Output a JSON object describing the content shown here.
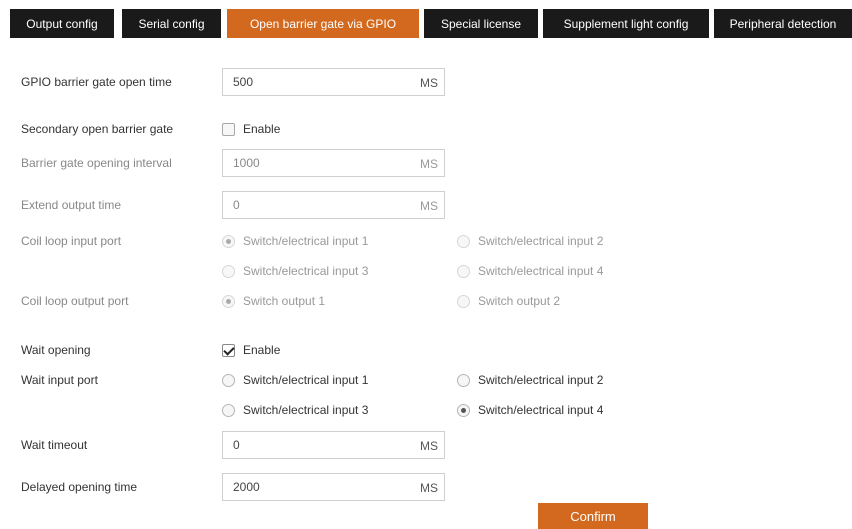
{
  "tabs": [
    {
      "label": "Output config"
    },
    {
      "label": "Serial config"
    },
    {
      "label": "Open barrier gate via GPIO"
    },
    {
      "label": "Special license"
    },
    {
      "label": "Supplement light config"
    },
    {
      "label": "Peripheral detection"
    }
  ],
  "active_tab": "Open barrier gate via GPIO",
  "form": {
    "gpio_open_time": {
      "label": "GPIO barrier gate open time",
      "value": "500",
      "unit": "MS"
    },
    "secondary_open": {
      "label": "Secondary open barrier gate",
      "option": "Enable",
      "checked": false
    },
    "opening_interval": {
      "label": "Barrier gate opening interval",
      "value": "1000",
      "unit": "MS"
    },
    "extend_output": {
      "label": "Extend output time",
      "value": "0",
      "unit": "MS"
    },
    "coil_input": {
      "label": "Coil loop input port",
      "options": [
        "Switch/electrical input 1",
        "Switch/electrical input 2",
        "Switch/electrical input 3",
        "Switch/electrical input 4"
      ],
      "selected": "Switch/electrical input 1"
    },
    "coil_output": {
      "label": "Coil loop output port",
      "options": [
        "Switch output 1",
        "Switch output 2"
      ],
      "selected": "Switch output 1"
    },
    "wait_opening": {
      "label": "Wait opening",
      "option": "Enable",
      "checked": true
    },
    "wait_input": {
      "label": "Wait input port",
      "options": [
        "Switch/electrical input 1",
        "Switch/electrical input 2",
        "Switch/electrical input 3",
        "Switch/electrical input 4"
      ],
      "selected": "Switch/electrical input 4"
    },
    "wait_timeout": {
      "label": "Wait timeout",
      "value": "0",
      "unit": "MS"
    },
    "delayed_opening": {
      "label": "Delayed opening time",
      "value": "2000",
      "unit": "MS"
    }
  },
  "confirm_label": "Confirm",
  "colors": {
    "accent": "#d2691e",
    "tab_bg": "#1a1a1a"
  }
}
